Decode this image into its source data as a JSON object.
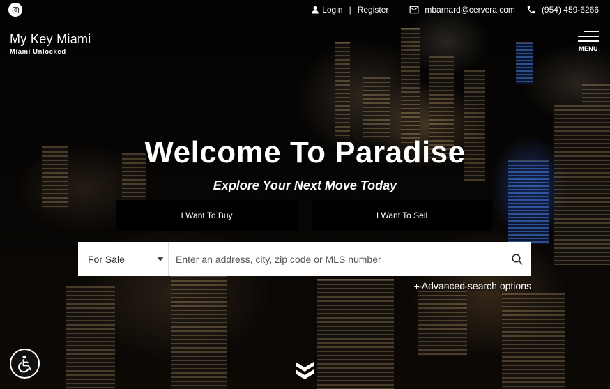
{
  "topbar": {
    "login_label": "Login",
    "register_label": "Register",
    "email": "mbarnard@cervera.com",
    "phone": "(954) 459-6266"
  },
  "brand": {
    "title": "My Key Miami",
    "tagline": "Miami Unlocked"
  },
  "menu": {
    "label": "MENU"
  },
  "hero": {
    "title": "Welcome To Paradise",
    "subtitle": "Explore Your Next Move Today",
    "buy_label": "I Want To Buy",
    "sell_label": "I Want To Sell"
  },
  "search": {
    "type_selected": "For Sale",
    "placeholder": "Enter an address, city, zip code or MLS number",
    "advanced_label": "+ Advanced search options"
  },
  "icons": {
    "social": "instagram-icon",
    "login": "user-icon",
    "email": "envelope-icon",
    "phone": "phone-icon",
    "search": "search-icon",
    "accessibility": "wheelchair-icon",
    "scroll": "double-chevron-down-icon"
  }
}
